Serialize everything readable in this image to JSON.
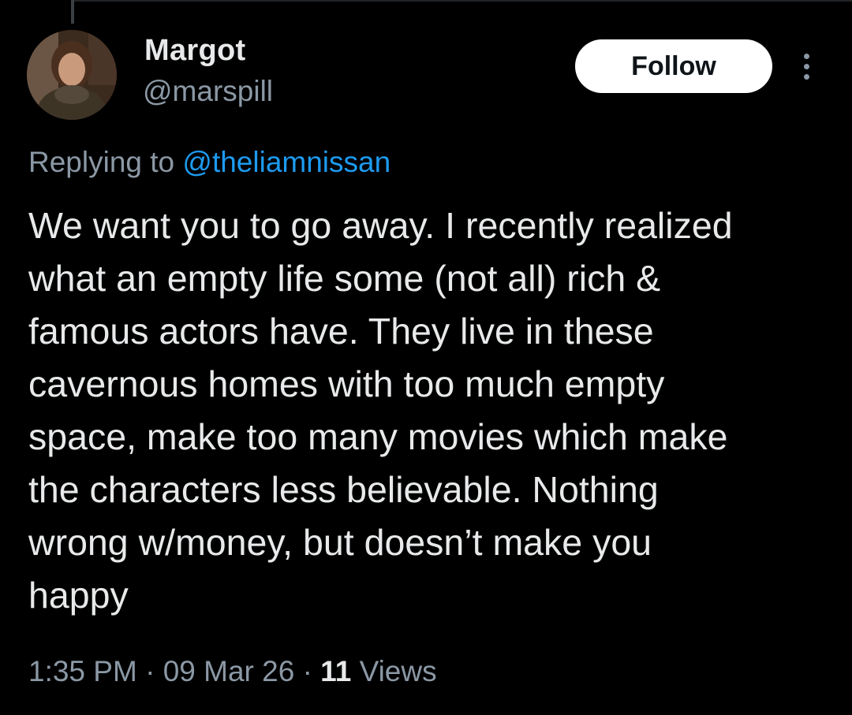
{
  "post": {
    "author": {
      "name": "Margot",
      "handle": "@marspill",
      "avatar_icon": "profile-photo"
    },
    "actions": {
      "follow_label": "Follow",
      "more_icon": "more-vertical-icon"
    },
    "reply_context": {
      "prefix": "Replying to",
      "mention": "@theliamnissan"
    },
    "text": "We want you to go away. I recently realized\nwhat an empty life some (not all) rich &\nfamous actors have. They live in these\ncavernous homes with too much empty\nspace, make too many movies which make\nthe characters less believable. Nothing\nwrong w/money, but doesn’t make you\nhappy",
    "meta": {
      "time": "1:35 PM",
      "date": "09 Mar 26",
      "views_count": "11",
      "views_label": "Views"
    }
  },
  "colors": {
    "background": "#000000",
    "primary_text": "#e7e9ea",
    "secondary_text": "#8b98a5",
    "link": "#1d9bf0",
    "follow_bg": "#ffffff",
    "follow_text": "#0f1419"
  }
}
